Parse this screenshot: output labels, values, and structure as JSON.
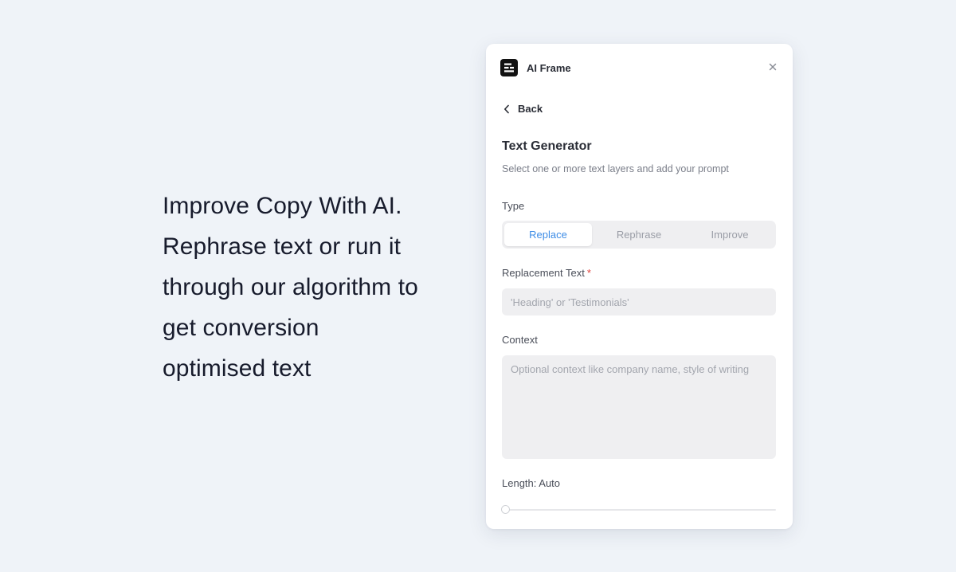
{
  "headline": {
    "lines": [
      "Improve Copy With AI.",
      "Rephrase text or run it",
      "through our algorithm to",
      "get conversion",
      "optimised text"
    ]
  },
  "panel": {
    "app_title": "AI Frame",
    "logo_icon": "ai-frame-logo-icon",
    "close_icon": "close-icon",
    "back_label": "Back",
    "title": "Text Generator",
    "subtitle": "Select one or more text layers and add your prompt",
    "type": {
      "label": "Type",
      "options": [
        "Replace",
        "Rephrase",
        "Improve"
      ],
      "selected": "Replace"
    },
    "replacement": {
      "label": "Replacement Text",
      "required_mark": "*",
      "placeholder": "'Heading' or 'Testimonials'",
      "value": ""
    },
    "context": {
      "label": "Context",
      "placeholder": "Optional context like company name, style of writing",
      "value": ""
    },
    "length": {
      "label": "Length: Auto",
      "slider_value": 0
    }
  },
  "colors": {
    "background": "#eff3f8",
    "accent": "#3d8ce6",
    "required": "#e0403a"
  }
}
